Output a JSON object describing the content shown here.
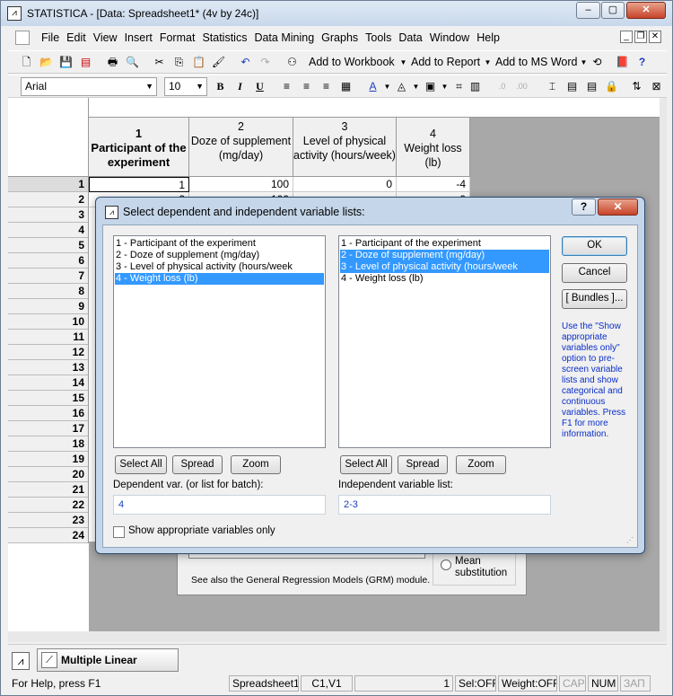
{
  "window": {
    "title": "STATISTICA - [Data: Spreadsheet1* (4v by 24c)]",
    "controls": {
      "minimize": "–",
      "maximize": "▢",
      "close": "✕"
    }
  },
  "menubar": {
    "items": [
      "File",
      "Edit",
      "View",
      "Insert",
      "Format",
      "Statistics",
      "Data Mining",
      "Graphs",
      "Tools",
      "Data",
      "Window",
      "Help"
    ],
    "mdi_controls": [
      "_",
      "❐",
      "✕"
    ]
  },
  "toolbar1": {
    "add_workbook": "Add to Workbook",
    "add_report": "Add to Report",
    "add_msword": "Add to MS Word"
  },
  "toolbar2": {
    "font": "Arial",
    "size": "10",
    "bold": "B",
    "italic": "I",
    "underline": "U"
  },
  "spreadsheet": {
    "columns": [
      {
        "num": "1",
        "name": "Participant of the experiment"
      },
      {
        "num": "2",
        "name": "Doze of supplement (mg/day)"
      },
      {
        "num": "3",
        "name": "Level of physical activity (hours/week)"
      },
      {
        "num": "4",
        "name": "Weight loss (lb)"
      }
    ],
    "row_numbers": [
      "1",
      "2",
      "3",
      "4",
      "5",
      "6",
      "7",
      "8",
      "9",
      "10",
      "11",
      "12",
      "13",
      "14",
      "15",
      "16",
      "17",
      "18",
      "19",
      "20",
      "21",
      "22",
      "23",
      "24"
    ],
    "first_row": [
      "1",
      "100",
      "0",
      "-4"
    ],
    "second_row_partial": [
      "2",
      "100",
      "",
      "0"
    ]
  },
  "behind_dialog": {
    "radio_label": "Mean substitution",
    "note": "See also the General Regression Models (GRM) module."
  },
  "dialog": {
    "title": "Select dependent and independent variable lists:",
    "help": "?",
    "close": "✕",
    "left_list": [
      "1 - Participant of the experiment",
      "2 - Doze of supplement (mg/day)",
      "3 - Level of physical activity (hours/week",
      "4 - Weight loss (lb)"
    ],
    "right_list": [
      "1 - Participant of the experiment",
      "2 - Doze of supplement (mg/day)",
      "3 - Level of physical activity (hours/week",
      "4 - Weight loss (lb)"
    ],
    "select_all": "Select All",
    "spread": "Spread",
    "zoom": "Zoom",
    "dependent_label": "Dependent var. (or list for batch):",
    "dependent_value": "4",
    "independent_label": "Independent variable list:",
    "independent_value": "2-3",
    "ok": "OK",
    "cancel": "Cancel",
    "bundles": "[ Bundles ]...",
    "hint": "Use the \"Show appropriate variables only\" option to pre-screen variable lists and show categorical and continuous variables. Press F1 for more information.",
    "show_appropriate": "Show appropriate variables only"
  },
  "taskbar": {
    "item": "Multiple Linear Regre..."
  },
  "statusbar": {
    "help": "For Help, press F1",
    "sheet": "Spreadsheet1",
    "cell": "C1,V1",
    "value": "1",
    "sel": "Sel:OFF",
    "weight": "Weight:OFF",
    "cap": "CAP",
    "num": "NUM",
    "scrl": "ЗАП"
  },
  "colors": {
    "selection": "#3399ff",
    "hint_text": "#0a2ec8",
    "dialog_frame": "#c5d6ea"
  }
}
